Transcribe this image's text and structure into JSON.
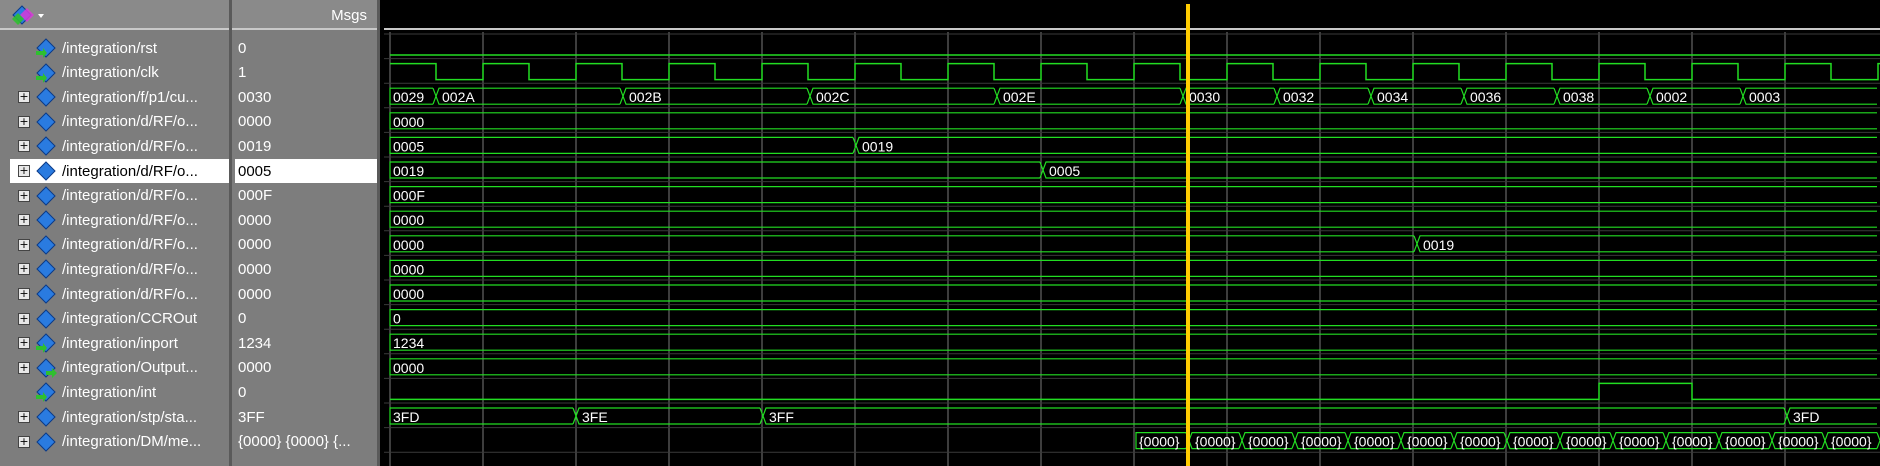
{
  "header": {
    "msgs_label": "Msgs"
  },
  "signals": [
    {
      "name": "/integration/rst",
      "value": "0",
      "expandable": false,
      "kind": "in",
      "selected": false
    },
    {
      "name": "/integration/clk",
      "value": "1",
      "expandable": false,
      "kind": "in",
      "selected": false
    },
    {
      "name": "/integration/f/p1/cu...",
      "value": "0030",
      "expandable": true,
      "kind": "normal",
      "selected": false
    },
    {
      "name": "/integration/d/RF/o...",
      "value": "0000",
      "expandable": true,
      "kind": "normal",
      "selected": false
    },
    {
      "name": "/integration/d/RF/o...",
      "value": "0019",
      "expandable": true,
      "kind": "normal",
      "selected": false
    },
    {
      "name": "/integration/d/RF/o...",
      "value": "0005",
      "expandable": true,
      "kind": "normal",
      "selected": true
    },
    {
      "name": "/integration/d/RF/o...",
      "value": "000F",
      "expandable": true,
      "kind": "normal",
      "selected": false
    },
    {
      "name": "/integration/d/RF/o...",
      "value": "0000",
      "expandable": true,
      "kind": "normal",
      "selected": false
    },
    {
      "name": "/integration/d/RF/o...",
      "value": "0000",
      "expandable": true,
      "kind": "normal",
      "selected": false
    },
    {
      "name": "/integration/d/RF/o...",
      "value": "0000",
      "expandable": true,
      "kind": "normal",
      "selected": false
    },
    {
      "name": "/integration/d/RF/o...",
      "value": "0000",
      "expandable": true,
      "kind": "normal",
      "selected": false
    },
    {
      "name": "/integration/CCROut",
      "value": "0",
      "expandable": true,
      "kind": "normal",
      "selected": false
    },
    {
      "name": "/integration/inport",
      "value": "1234",
      "expandable": true,
      "kind": "in",
      "selected": false
    },
    {
      "name": "/integration/Output...",
      "value": "0000",
      "expandable": true,
      "kind": "out",
      "selected": false
    },
    {
      "name": "/integration/int",
      "value": "0",
      "expandable": false,
      "kind": "in",
      "selected": false
    },
    {
      "name": "/integration/stp/sta...",
      "value": "3FF",
      "expandable": true,
      "kind": "normal",
      "selected": false
    },
    {
      "name": "/integration/DM/me...",
      "value": "{0000} {0000} {...",
      "expandable": true,
      "kind": "normal",
      "selected": false
    }
  ],
  "waves": {
    "rst": {
      "type": "bit",
      "transitions": [
        [
          0,
          0
        ]
      ]
    },
    "clk": {
      "type": "clock",
      "start_cycle": 0,
      "cycles": 16
    },
    "int": {
      "type": "bit",
      "transitions": [
        [
          0,
          0
        ],
        [
          13,
          1
        ],
        [
          14,
          0
        ]
      ]
    },
    "pc_bus": [
      "0029",
      "002A",
      "002B",
      "002C",
      "002E",
      "0030",
      "0032",
      "0034",
      "0036",
      "0038",
      "0002",
      "0003"
    ],
    "r0_bus": [
      "0000"
    ],
    "r1_bus": [
      "0005",
      "0019"
    ],
    "r2_bus": [
      "0019",
      "0005"
    ],
    "r3_bus": [
      "000F"
    ],
    "r4_bus": [
      "0000"
    ],
    "r5_bus": [
      "0000",
      "0019"
    ],
    "r6_bus": [
      "0000"
    ],
    "r7_bus": [
      "0000"
    ],
    "ccr_bus": [
      "0"
    ],
    "inport_bus": [
      "1234"
    ],
    "output_bus": [
      "0000"
    ],
    "stp_bus": [
      "3FD",
      "3FE",
      "3FF",
      "3FD"
    ],
    "dm_bus": [
      "{0000}",
      "{0000}",
      "{0000}",
      "{0000}",
      "{0000}",
      "{0000}",
      "{0000}",
      "{0000}",
      "{0000}",
      "{0000}",
      "{0000}",
      "{0000}",
      "{0000}",
      "{0000}",
      "{..."
    ]
  },
  "colors": {
    "wave": "#22dd22",
    "cursor": "#ffcc00",
    "grid": "#7a7a7a",
    "diamond": "#2a7be0",
    "arrow": "#2fbf2f"
  }
}
